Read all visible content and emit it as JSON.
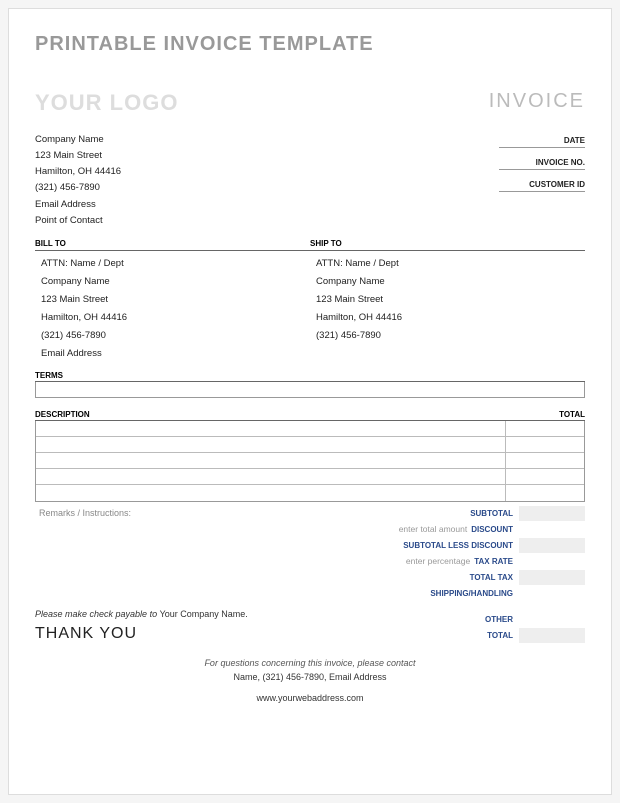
{
  "title": "PRINTABLE INVOICE TEMPLATE",
  "logo_text": "YOUR LOGO",
  "invoice_label": "INVOICE",
  "company": {
    "name": "Company Name",
    "street": "123 Main Street",
    "city": "Hamilton, OH 44416",
    "phone": "(321) 456-7890",
    "email": "Email Address",
    "contact": "Point of Contact"
  },
  "right_labels": {
    "date": "DATE",
    "invoice_no": "INVOICE NO.",
    "customer_id": "CUSTOMER ID"
  },
  "bill_to": {
    "heading": "BILL TO",
    "attn": "ATTN: Name / Dept",
    "company": "Company Name",
    "street": "123 Main Street",
    "city": "Hamilton, OH 44416",
    "phone": "(321) 456-7890",
    "email": "Email Address"
  },
  "ship_to": {
    "heading": "SHIP TO",
    "attn": "ATTN: Name / Dept",
    "company": "Company Name",
    "street": "123 Main Street",
    "city": "Hamilton, OH 44416",
    "phone": "(321) 456-7890"
  },
  "terms_heading": "TERMS",
  "items_heading": {
    "description": "DESCRIPTION",
    "total": "TOTAL"
  },
  "remarks_label": "Remarks / Instructions:",
  "totals": {
    "subtotal": "SUBTOTAL",
    "discount_hint": "enter total amount",
    "discount": "DISCOUNT",
    "subtotal_less": "SUBTOTAL LESS DISCOUNT",
    "taxrate_hint": "enter percentage",
    "taxrate": "TAX RATE",
    "totaltax": "TOTAL TAX",
    "shipping": "SHIPPING/HANDLING",
    "other": "OTHER",
    "total": "TOTAL"
  },
  "payable_prefix": "Please make check payable to ",
  "payable_name": "Your Company Name.",
  "thank_you": "THANK YOU",
  "footer": {
    "question": "For questions concerning this invoice, please contact",
    "contact": "Name, (321) 456-7890, Email Address",
    "web": "www.yourwebaddress.com"
  }
}
